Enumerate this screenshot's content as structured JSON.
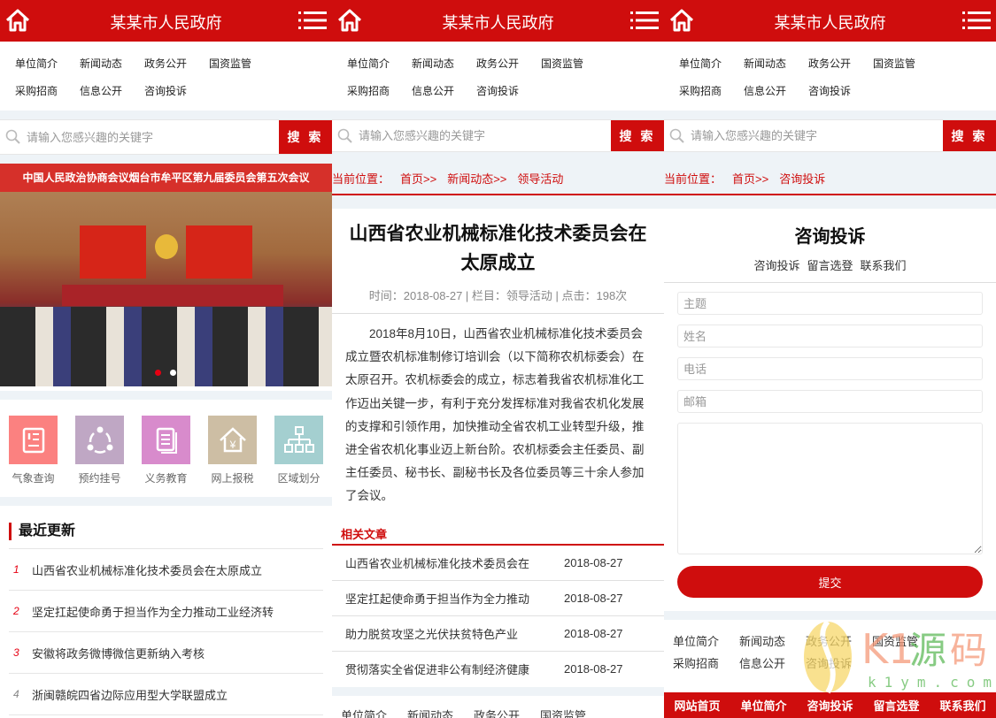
{
  "header": {
    "title": "某某市人民政府",
    "home_icon": "home-icon",
    "menu_icon": "menu-icon"
  },
  "nav": [
    "单位简介",
    "新闻动态",
    "政务公开",
    "国资监管",
    "采购招商",
    "信息公开",
    "咨询投诉"
  ],
  "search": {
    "placeholder": "请输入您感兴趣的关键字",
    "button": "搜 索"
  },
  "banner": {
    "caption": "中国人民政治协商会议烟台市牟平区第九届委员会第五次会议",
    "slides": 2,
    "active": 1
  },
  "services": [
    {
      "label": "气象查询",
      "color": "#fb8180",
      "icon": "weather-doc-icon"
    },
    {
      "label": "预约挂号",
      "color": "#bfa7c4",
      "icon": "appointment-icon"
    },
    {
      "label": "义务教育",
      "color": "#d88bcc",
      "icon": "education-icon"
    },
    {
      "label": "网上报税",
      "color": "#cdbea4",
      "icon": "tax-icon"
    },
    {
      "label": "区域划分",
      "color": "#a4cfd0",
      "icon": "region-icon"
    }
  ],
  "recent": {
    "title": "最近更新",
    "items": [
      {
        "num": "1",
        "text": "山西省农业机械标准化技术委员会在太原成立",
        "color": "#e60012"
      },
      {
        "num": "2",
        "text": "坚定扛起使命勇于担当作为全力推动工业经济转",
        "color": "#e60012"
      },
      {
        "num": "3",
        "text": "安徽将政务微博微信更新纳入考核",
        "color": "#e60012"
      },
      {
        "num": "4",
        "text": "浙闽赣皖四省边际应用型大学联盟成立",
        "color": "#888888"
      }
    ]
  },
  "article": {
    "crumb": [
      "当前位置：",
      "首页>>",
      "新闻动态>>",
      "领导活动"
    ],
    "title": "山西省农业机械标准化技术委员会在太原成立",
    "meta": "时间：2018-08-27 | 栏目：领导活动 | 点击：198次",
    "body": "2018年8月10日，山西省农业机械标准化技术委员会成立暨农机标准制修订培训会（以下简称农机标委会）在太原召开。农机标委会的成立，标志着我省农机标准化工作迈出关键一步，有利于充分发挥标准对我省农机化发展的支撑和引领作用，加快推动全省农机工业转型升级，推进全省农机化事业迈上新台阶。农机标委会主任委员、副主任委员、秘书长、副秘书长及各位委员等三十余人参加了会议。",
    "related_title": "相关文章",
    "related": [
      {
        "title": "山西省农业机械标准化技术委员会在",
        "date": "2018-08-27"
      },
      {
        "title": "坚定扛起使命勇于担当作为全力推动",
        "date": "2018-08-27"
      },
      {
        "title": "助力脱贫攻坚之光伏扶贫特色产业",
        "date": "2018-08-27"
      },
      {
        "title": "贯彻落实全省促进非公有制经济健康",
        "date": "2018-08-27"
      }
    ]
  },
  "consult": {
    "crumb": [
      "当前位置：",
      "首页>>",
      "咨询投诉"
    ],
    "title": "咨询投诉",
    "tabs": [
      "咨询投诉",
      "留言选登",
      "联系我们"
    ],
    "fields": [
      "主题",
      "姓名",
      "电话",
      "邮箱"
    ],
    "submit": "提交",
    "bottom": [
      "网站首页",
      "单位简介",
      "咨询投诉",
      "留言选登",
      "联系我们"
    ]
  },
  "watermark": {
    "brand": "K1源码",
    "url": "k1ym.com"
  },
  "colors": {
    "primary": "#cf0d0d",
    "gap": "#eef3f7"
  }
}
